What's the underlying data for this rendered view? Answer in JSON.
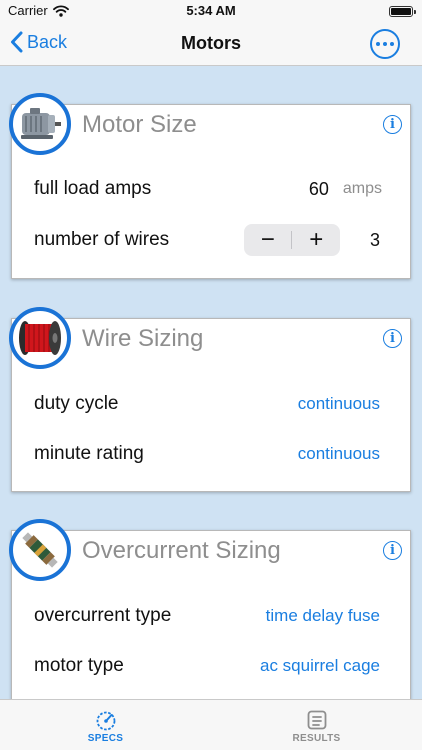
{
  "status": {
    "carrier": "Carrier",
    "time": "5:34 AM"
  },
  "nav": {
    "back_label": "Back",
    "title": "Motors",
    "more_icon": "more-icon"
  },
  "cards": {
    "motor": {
      "title": "Motor Size",
      "icon": "motor-icon",
      "full_load_amps_label": "full load amps",
      "full_load_amps_value": "60",
      "full_load_amps_unit": "amps",
      "wires_label": "number of wires",
      "wires_value": "3",
      "stepper_minus": "−",
      "stepper_plus": "+"
    },
    "wire": {
      "title": "Wire Sizing",
      "icon": "wire-spool-icon",
      "duty_cycle_label": "duty cycle",
      "duty_cycle_value": "continuous",
      "minute_rating_label": "minute rating",
      "minute_rating_value": "continuous"
    },
    "overcurrent": {
      "title": "Overcurrent Sizing",
      "icon": "fuse-icon",
      "type_label": "overcurrent type",
      "type_value": "time delay fuse",
      "motor_type_label": "motor type",
      "motor_type_value": "ac squirrel cage"
    }
  },
  "tabs": [
    {
      "label": "SPECS",
      "icon": "gauge-icon",
      "active": true
    },
    {
      "label": "RESULTS",
      "icon": "list-icon",
      "active": false
    }
  ],
  "colors": {
    "accent": "#1a7ee0",
    "ring": "#1a73d6",
    "background": "#cfe2f3",
    "title_gray": "#8e8e8e"
  }
}
